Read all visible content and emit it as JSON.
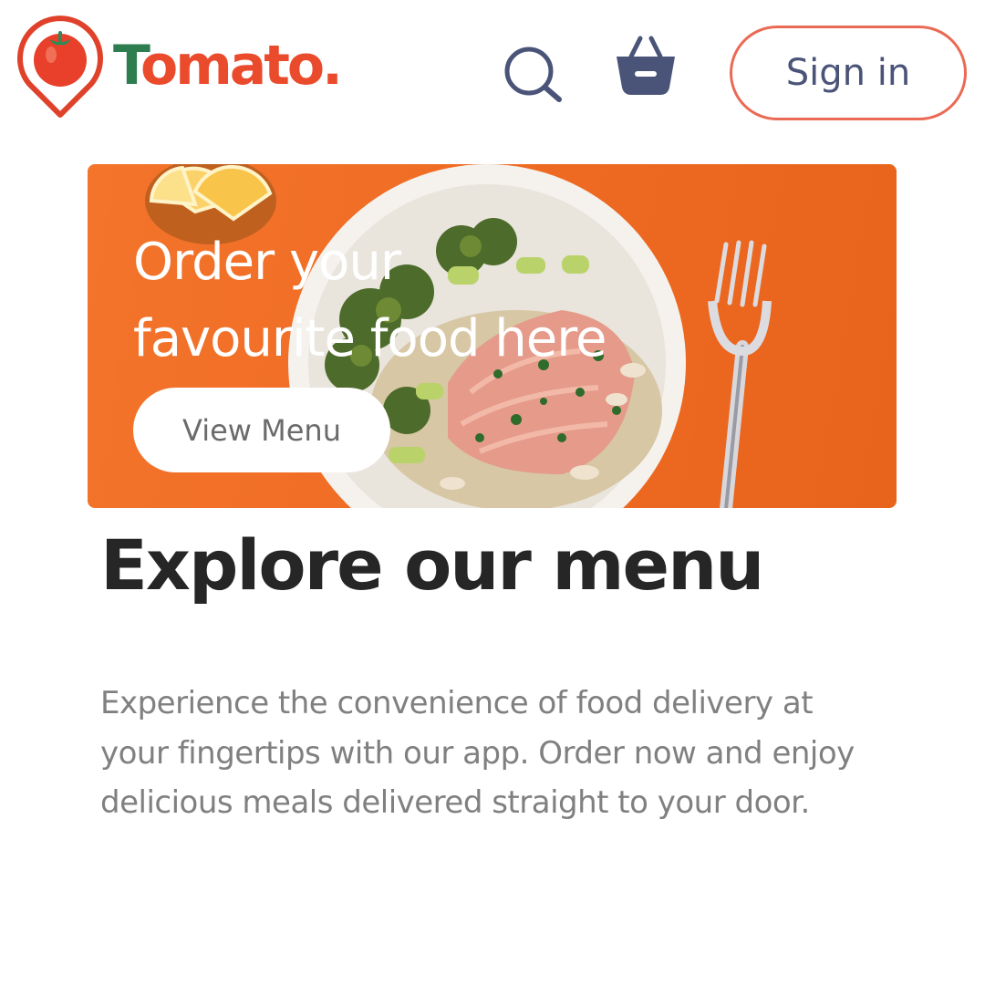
{
  "header": {
    "logo": {
      "first_letter": "T",
      "rest": "omato."
    },
    "search_icon": "search-icon",
    "basket_icon": "basket-icon",
    "signin_label": "Sign in"
  },
  "hero": {
    "title_line1": "Order your",
    "title_line2": "favourite food here",
    "button_label": "View Menu",
    "background_color": "#ee6a22"
  },
  "menu_section": {
    "title": "Explore our menu",
    "description": "Experience the convenience of food delivery at your fingertips with our app. Order now and enjoy delicious meals delivered straight to your door."
  },
  "colors": {
    "brand_green": "#2e7d4f",
    "brand_red": "#ea4b2c",
    "signin_border": "#ea6a55",
    "icon_navy": "#4a5478"
  }
}
